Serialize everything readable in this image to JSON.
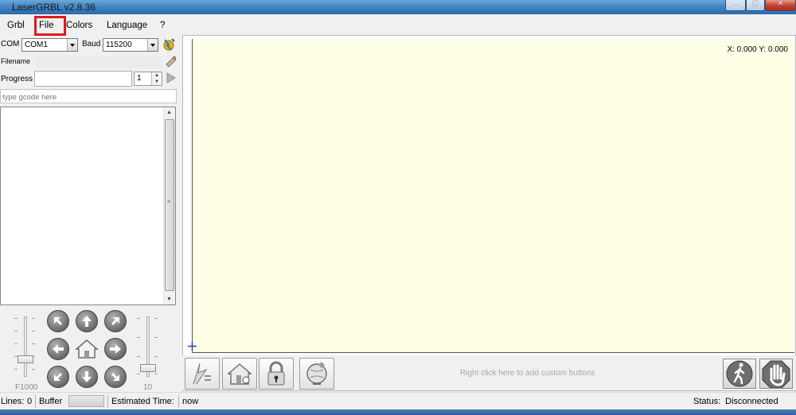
{
  "window": {
    "title": "LaserGRBL v2.8.36"
  },
  "menu": {
    "items": [
      "Grbl",
      "File",
      "Colors",
      "Language",
      "?"
    ]
  },
  "connection": {
    "com_label": "COM",
    "com_value": "COM1",
    "baud_label": "Baud",
    "baud_value": "115200",
    "filename_label": "Filename",
    "progress_label": "Progress",
    "progress_count": "1"
  },
  "gcode": {
    "placeholder": "type gcode here"
  },
  "jog": {
    "feed_label": "F1000",
    "step_label": "10",
    "buttons": [
      "jog-up-left",
      "jog-up",
      "jog-up-right",
      "jog-left",
      "jog-home",
      "jog-right",
      "jog-down-left",
      "jog-down",
      "jog-down-right"
    ]
  },
  "canvas": {
    "coords": "X: 0.000 Y: 0.000",
    "background": "#ffffe6"
  },
  "toolbar": {
    "custom_hint": "Right click here to add custom buttons",
    "buttons": [
      "reset-grbl-icon",
      "homing-icon",
      "unlock-icon",
      "globe-pin-icon"
    ]
  },
  "status": {
    "lines_label": "Lines:",
    "lines_value": "0",
    "buffer_label": "Buffer",
    "estimated_label": "Estimated Time:",
    "estimated_value": "now",
    "status_label": "Status:",
    "status_value": "Disconnected"
  },
  "colors": {
    "highlight": "#e01a1a",
    "titlebar": "#3d7fc0"
  }
}
